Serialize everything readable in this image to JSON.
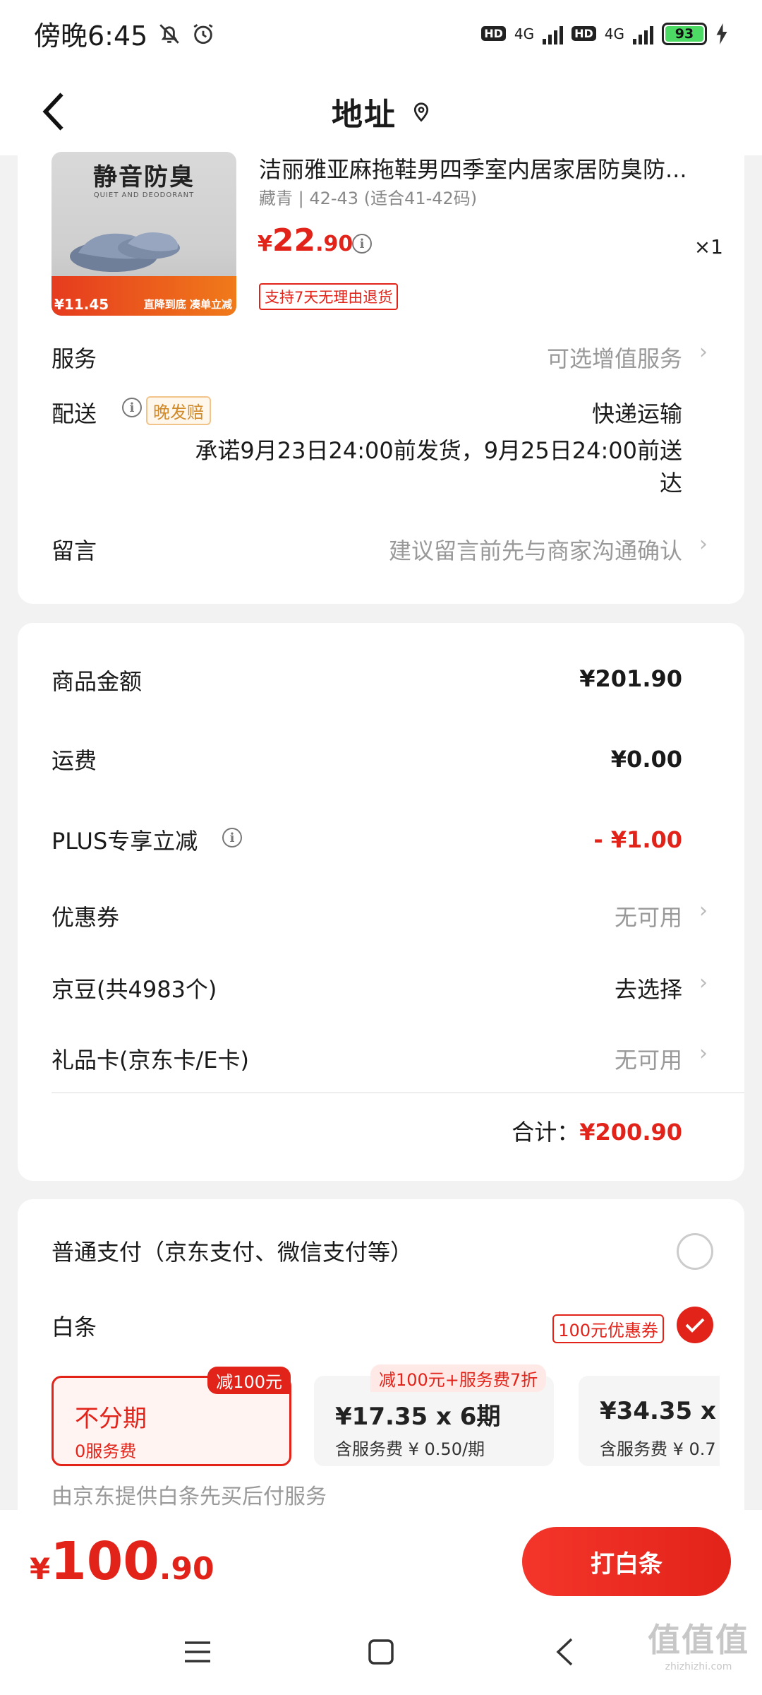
{
  "status_bar": {
    "time": "傍晚6:45",
    "hd1": "HD",
    "net1": "4G",
    "hd2": "HD",
    "net2": "4G",
    "battery": "93",
    "icons": [
      "bell-off-icon",
      "alarm-icon",
      "signal-icon",
      "battery-icon",
      "charging-icon"
    ]
  },
  "header": {
    "title": "地址",
    "back_icon": "chevron-left-icon",
    "location_icon": "location-pin-icon"
  },
  "product": {
    "thumb_title": "静音防臭",
    "thumb_sub": "QUIET AND DEODORANT",
    "thumb_price": "¥11.45",
    "thumb_badge": "直降到底 凑单立减",
    "title": "洁丽雅亚麻拖鞋男四季室内居家居防臭防...",
    "spec": "藏青 | 42-43 (适合41-42码)",
    "price_symbol": "¥",
    "price_int": "22",
    "price_dec": ".90",
    "quantity": "×1",
    "return_tag": "支持7天无理由退货"
  },
  "service": {
    "label": "服务",
    "value": "可选增值服务"
  },
  "delivery": {
    "label": "配送",
    "tag": "晚发赔",
    "method": "快递运输",
    "promise": "承诺9月23日24:00前发货，9月25日24:00前送达"
  },
  "message": {
    "label": "留言",
    "placeholder": "建议留言前先与商家沟通确认"
  },
  "summary": {
    "goods_label": "商品金额",
    "goods_value": "¥201.90",
    "shipping_label": "运费",
    "shipping_value": "¥0.00",
    "plus_label": "PLUS专享立减",
    "plus_value": "- ¥1.00",
    "coupon_label": "优惠券",
    "coupon_value": "无可用",
    "beans_label": "京豆(共4983个)",
    "beans_value": "去选择",
    "gift_label": "礼品卡(京东卡/E卡)",
    "gift_value": "无可用",
    "total_label": "合计：",
    "total_value": "¥200.90"
  },
  "payment": {
    "normal_label": "普通支付（京东支付、微信支付等）",
    "baitiao_label": "白条",
    "coupon_tag": "100元优惠券",
    "plans": [
      {
        "main": "不分期",
        "sub": "0服务费",
        "badge": "减100元"
      },
      {
        "main": "¥17.35 x 6期",
        "sub": "含服务费 ¥ 0.50/期",
        "badge": "减100元+服务费7折"
      },
      {
        "main": "¥34.35 x",
        "sub": "含服务费 ¥ 0.7"
      }
    ],
    "provider_text": "由京东提供白条先买后付服务"
  },
  "bottom": {
    "total_symbol": "¥",
    "total_int": "100",
    "total_dec": ".90",
    "pay_button": "打白条"
  },
  "watermark": {
    "logo": "值值值",
    "url": "zhizhizhi.com"
  },
  "colors": {
    "accent": "#e2231a",
    "background": "#f2f2f2",
    "muted": "#999999"
  }
}
